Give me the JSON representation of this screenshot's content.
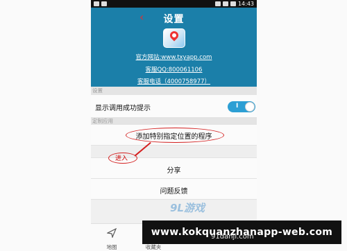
{
  "status_bar": {
    "time": "14:43"
  },
  "header": {
    "back_icon": "back-arrow-icon",
    "title": "设置",
    "website": "官方网站:www.txyapp.com",
    "qq": "客服QQ:800061106",
    "phone": "客服电话（4000758977）"
  },
  "section_settings": {
    "label": "设置"
  },
  "toggle_row": {
    "label": "显示调用成功提示",
    "state": "I"
  },
  "section_custom": {
    "label": "定制应用"
  },
  "custom_row": {
    "label": "添加特别指定位置的程序"
  },
  "annotation": {
    "label": "进入"
  },
  "share_row": {
    "label": "分享"
  },
  "feedback_row": {
    "label": "问题反馈"
  },
  "tabs": [
    {
      "label": "地图",
      "icon": "navigation-icon"
    },
    {
      "label": "收藏夹",
      "icon": "favorites-icon"
    }
  ],
  "watermark": {
    "logo": "9L游戏",
    "url": "91danji.com"
  },
  "banner": {
    "text": "www.kokquanzhanapp-web.com"
  },
  "colors": {
    "header_bg": "#1b7fa9",
    "toggle_on": "#2d9fd4",
    "annotation_red": "#d42020"
  }
}
